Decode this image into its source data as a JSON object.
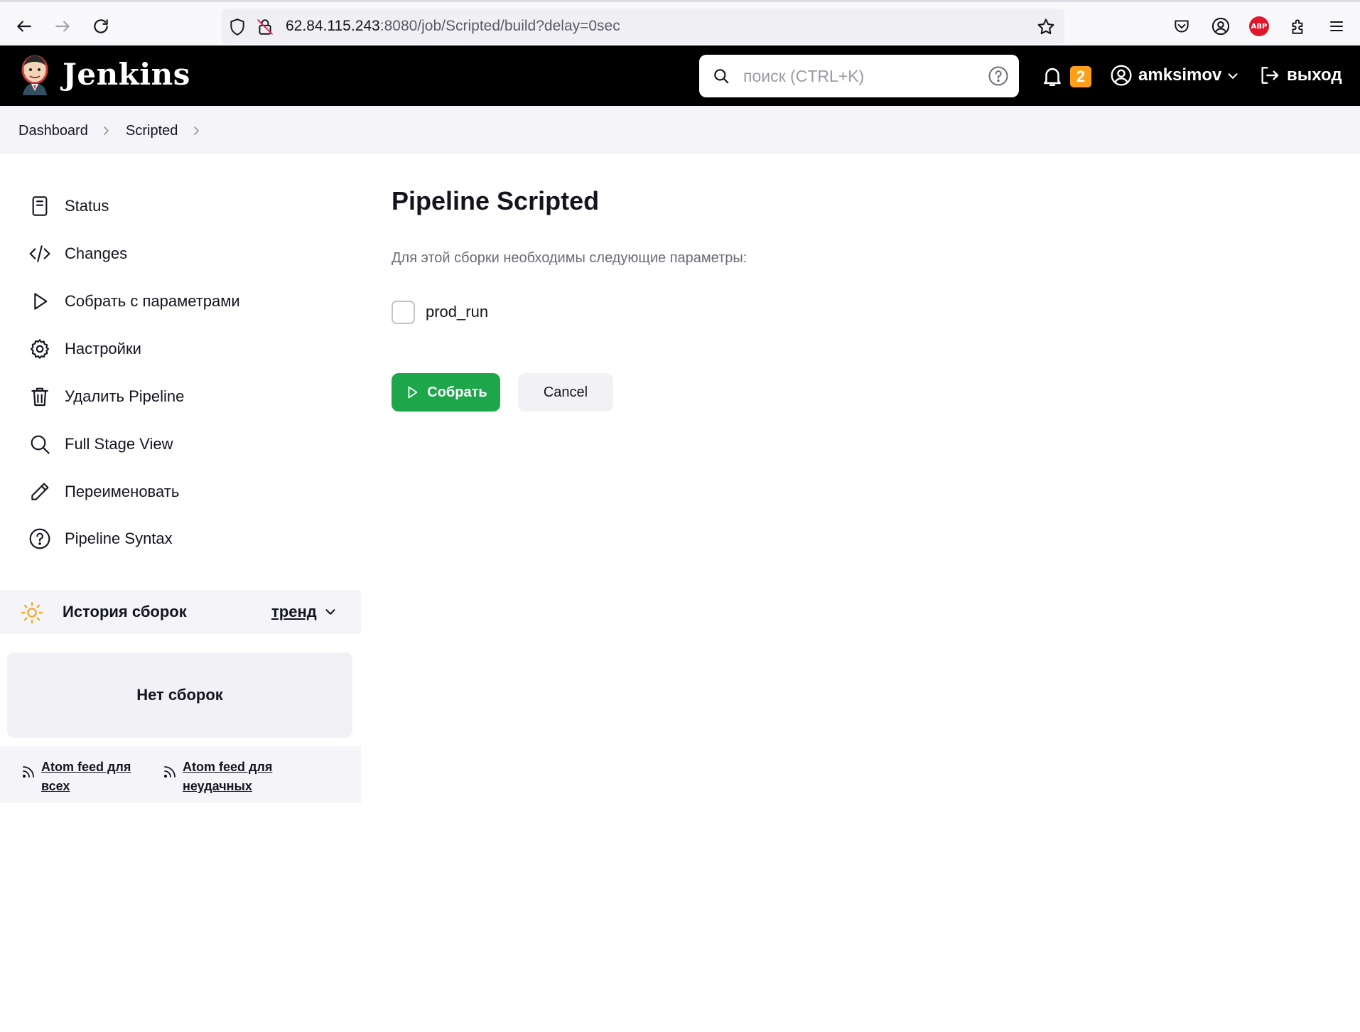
{
  "browser": {
    "url_host": "62.84.115.243",
    "url_rest": ":8080/job/Scripted/build?delay=0sec",
    "abp_label": "ABP"
  },
  "header": {
    "brand": "Jenkins",
    "search_placeholder": "поиск (CTRL+K)",
    "notifications_count": "2",
    "username": "amksimov",
    "logout_label": "выход"
  },
  "breadcrumb": {
    "items": [
      "Dashboard",
      "Scripted"
    ]
  },
  "sidebar": {
    "tasks": [
      {
        "label": "Status",
        "icon": "status-icon"
      },
      {
        "label": "Changes",
        "icon": "code-icon"
      },
      {
        "label": "Собрать с параметрами",
        "icon": "play-icon"
      },
      {
        "label": "Настройки",
        "icon": "gear-icon"
      },
      {
        "label": "Удалить Pipeline",
        "icon": "trash-icon"
      },
      {
        "label": "Full Stage View",
        "icon": "search-icon"
      },
      {
        "label": "Переименовать",
        "icon": "pencil-icon"
      },
      {
        "label": "Pipeline Syntax",
        "icon": "help-icon"
      }
    ],
    "history": {
      "title": "История сборок",
      "trend_label": "тренд",
      "empty_label": "Нет сборок"
    },
    "feeds": [
      {
        "label": "Atom feed для всех"
      },
      {
        "label": "Atom feed для неудачных"
      }
    ]
  },
  "main": {
    "title": "Pipeline Scripted",
    "description": "Для этой сборки необходимы следующие параметры:",
    "param_label": "prod_run",
    "param_checked": false,
    "build_button": "Собрать",
    "cancel_button": "Cancel"
  }
}
